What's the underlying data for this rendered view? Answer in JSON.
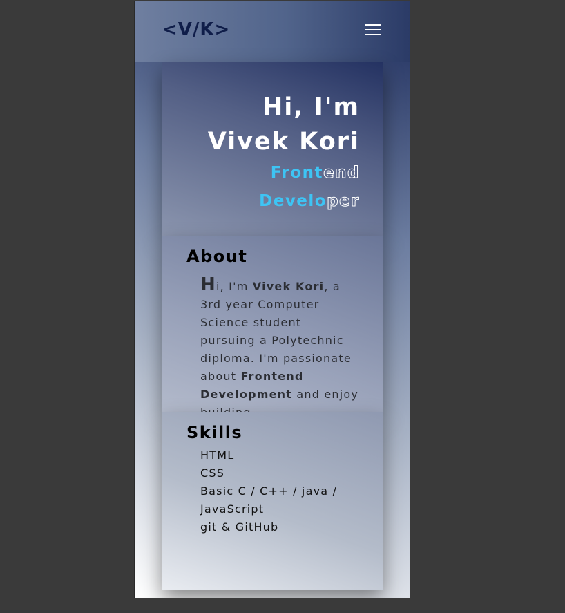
{
  "navbar": {
    "logo": "<V/K>"
  },
  "hero": {
    "greeting": "Hi, I'm",
    "name": "Vivek Kori",
    "role_line1_solid": "Front",
    "role_line1_hollow": "end",
    "role_line2_solid": "Develo",
    "role_line2_hollow": "per"
  },
  "about": {
    "title": "About",
    "drop_cap": "H",
    "text_start": "i, I'm ",
    "name_bold": "Vivek Kori",
    "text_mid": ", a 3rd year Computer Science student pursuing a Polytechnic diploma. I'm passionate about ",
    "focus_bold": "Frontend Development",
    "text_end": " and enjoy building"
  },
  "skills": {
    "title": "Skills",
    "items": [
      "HTML",
      "CSS",
      "Basic C / C++ / java / JavaScript",
      "git & GitHub"
    ]
  },
  "colors": {
    "accent": "#3ec4f4",
    "logo": "#0f1d49"
  }
}
